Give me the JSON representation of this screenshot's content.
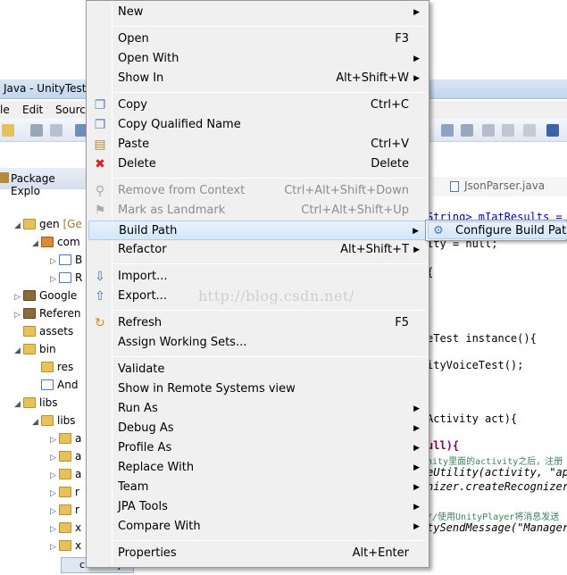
{
  "window": {
    "title": "Java - UnityTest"
  },
  "menubar": {
    "items": [
      "le",
      "Edit",
      "Sourc"
    ]
  },
  "package_explorer": {
    "title": "Package Explo",
    "tree": [
      {
        "arrow": "◢",
        "label": "gen",
        "suffix": "[Ge",
        "icon": "folder"
      },
      {
        "arrow": "◢",
        "label": "com",
        "icon": "pkg"
      },
      {
        "arrow": "▷",
        "label": "B",
        "icon": "jfile"
      },
      {
        "arrow": "▷",
        "label": "R",
        "icon": "jfile"
      },
      {
        "arrow": "▷",
        "label": "Google",
        "icon": "lib"
      },
      {
        "arrow": "▷",
        "label": "Referen",
        "icon": "lib"
      },
      {
        "arrow": "",
        "label": "assets",
        "icon": "folder"
      },
      {
        "arrow": "◢",
        "label": "bin",
        "icon": "folder"
      },
      {
        "arrow": "",
        "label": "res",
        "icon": "folder"
      },
      {
        "arrow": "",
        "label": "And",
        "icon": "jfile"
      },
      {
        "arrow": "◢",
        "label": "libs",
        "icon": "folder"
      },
      {
        "arrow": "◢",
        "label": "libs",
        "icon": "folder"
      },
      {
        "arrow": "▷",
        "label": "a",
        "icon": "folder"
      },
      {
        "arrow": "▷",
        "label": "a",
        "icon": "folder"
      },
      {
        "arrow": "▷",
        "label": "a",
        "icon": "folder"
      },
      {
        "arrow": "▷",
        "label": "r",
        "icon": "folder"
      },
      {
        "arrow": "▷",
        "label": "r",
        "icon": "folder"
      },
      {
        "arrow": "▷",
        "label": "x",
        "icon": "folder"
      },
      {
        "arrow": "▷",
        "label": "x",
        "icon": "folder"
      }
    ],
    "selected_item": "classes.jar"
  },
  "editor": {
    "tab_label": "JsonParser.java",
    "lines": [
      {
        "text": "String> mIatResults =",
        "style": "field"
      },
      {
        "text": "ity = null;",
        "style": "plain"
      },
      {
        "text": "{",
        "style": "plain"
      },
      {
        "text": "eTest instance(){",
        "style": "plain"
      },
      {
        "text": "ityVoiceTest();",
        "style": "plain"
      },
      {
        "text": "Activity act){",
        "style": "plain"
      },
      {
        "text": "ull){",
        "style": "kw"
      },
      {
        "text": "nity里面的activity之后，注册",
        "style": "cmt"
      },
      {
        "text": "eUtility(activity, \"app",
        "style": "mixed"
      },
      {
        "text": "nizer.createRecognizer",
        "style": "italic"
      },
      {
        "text": "//使用UnityPlayer将消息发送",
        "style": "cmt"
      },
      {
        "text": "tySendMessage(\"Manager\"",
        "style": "mixed"
      }
    ]
  },
  "context_menu": {
    "items": [
      {
        "label": "New",
        "shortcut": "",
        "submenu": true,
        "icon": ""
      },
      {
        "separator": true
      },
      {
        "label": "Open",
        "shortcut": "F3",
        "submenu": false,
        "icon": ""
      },
      {
        "label": "Open With",
        "shortcut": "",
        "submenu": true,
        "icon": ""
      },
      {
        "label": "Show In",
        "shortcut": "Alt+Shift+W",
        "submenu": true,
        "icon": ""
      },
      {
        "separator": true
      },
      {
        "label": "Copy",
        "shortcut": "Ctrl+C",
        "submenu": false,
        "icon": "copy-icon"
      },
      {
        "label": "Copy Qualified Name",
        "shortcut": "",
        "submenu": false,
        "icon": "copy-qualified-icon"
      },
      {
        "label": "Paste",
        "shortcut": "Ctrl+V",
        "submenu": false,
        "icon": "paste-icon"
      },
      {
        "label": "Delete",
        "shortcut": "Delete",
        "submenu": false,
        "icon": "delete-icon"
      },
      {
        "separator": true
      },
      {
        "label": "Remove from Context",
        "shortcut": "Ctrl+Alt+Shift+Down",
        "submenu": false,
        "icon": "remove-context-icon",
        "disabled": true
      },
      {
        "label": "Mark as Landmark",
        "shortcut": "Ctrl+Alt+Shift+Up",
        "submenu": false,
        "icon": "landmark-icon",
        "disabled": true
      },
      {
        "label": "Build Path",
        "shortcut": "",
        "submenu": true,
        "icon": "",
        "highlighted": true
      },
      {
        "label": "Refactor",
        "shortcut": "Alt+Shift+T",
        "submenu": true,
        "icon": ""
      },
      {
        "separator": true
      },
      {
        "label": "Import...",
        "shortcut": "",
        "submenu": false,
        "icon": "import-icon"
      },
      {
        "label": "Export...",
        "shortcut": "",
        "submenu": false,
        "icon": "export-icon"
      },
      {
        "separator": true
      },
      {
        "label": "Refresh",
        "shortcut": "F5",
        "submenu": false,
        "icon": "refresh-icon"
      },
      {
        "label": "Assign Working Sets...",
        "shortcut": "",
        "submenu": false,
        "icon": ""
      },
      {
        "separator": true
      },
      {
        "label": "Validate",
        "shortcut": "",
        "submenu": false,
        "icon": ""
      },
      {
        "label": "Show in Remote Systems view",
        "shortcut": "",
        "submenu": false,
        "icon": ""
      },
      {
        "label": "Run As",
        "shortcut": "",
        "submenu": true,
        "icon": ""
      },
      {
        "label": "Debug As",
        "shortcut": "",
        "submenu": true,
        "icon": ""
      },
      {
        "label": "Profile As",
        "shortcut": "",
        "submenu": true,
        "icon": ""
      },
      {
        "label": "Replace With",
        "shortcut": "",
        "submenu": true,
        "icon": ""
      },
      {
        "label": "Team",
        "shortcut": "",
        "submenu": true,
        "icon": ""
      },
      {
        "label": "JPA Tools",
        "shortcut": "",
        "submenu": true,
        "icon": ""
      },
      {
        "label": "Compare With",
        "shortcut": "",
        "submenu": true,
        "icon": ""
      },
      {
        "separator": true
      },
      {
        "label": "Properties",
        "shortcut": "Alt+Enter",
        "submenu": false,
        "icon": ""
      }
    ]
  },
  "submenu": {
    "label": "Configure Build Path...",
    "icon": "build-path-icon"
  },
  "watermark": "http://blog.csdn.net/",
  "colors": {
    "menu_bg": "#f0f0f0",
    "highlight": "#d4e6fa",
    "disabled_text": "#8d8d8d",
    "delete_red": "#d6221e"
  }
}
